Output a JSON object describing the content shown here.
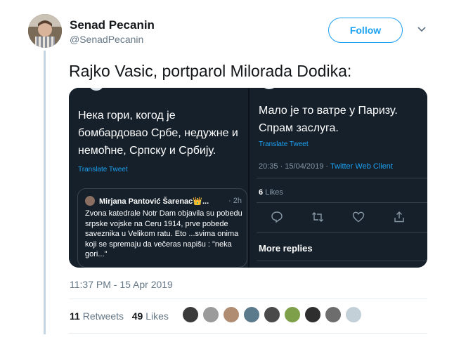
{
  "tweet": {
    "author": {
      "display_name": "Senad Pecanin",
      "handle": "@SenadPecanin"
    },
    "follow_label": "Follow",
    "text": "Rajko Vasic, portparol Milorada Dodika:",
    "timestamp": "11:37 PM - 15 Apr 2019",
    "retweets_count": "11",
    "retweets_label": "Retweets",
    "likes_count": "49",
    "likes_label": "Likes"
  },
  "screenshot_left": {
    "line1": "Нека гори, когод је",
    "line2": "бомбардовао Србе, недужне и",
    "line3": "немоћне, Српску и Србију.",
    "translate": "Translate Tweet",
    "quote": {
      "name": "Mirjana Pantović Šarenac👑...",
      "time": "· 2h",
      "body": "Zvona katedrale Notr Dam objavila su pobedu srpske vojske na Ceru 1914, prve pobede saveznika u Velikom ratu. Eto ...svima onima koji se spremaju da večeras napišu : \"neka gori...\""
    }
  },
  "screenshot_right": {
    "line1": "Мало је то ватре у Паризу.",
    "line2": "Спрам заслуга.",
    "translate": "Translate Tweet",
    "meta_time": "20:35 · 15/04/2019 · ",
    "meta_client": "Twitter Web Client",
    "likes_count": "6",
    "likes_label": "Likes",
    "more_replies": "More replies"
  },
  "colors": {
    "accent": "#1da1f2",
    "dark_bg": "#15202b",
    "muted": "#657786"
  },
  "likers": [
    {
      "name": "liker-avatar",
      "color": "#3a3a3a"
    },
    {
      "name": "liker-avatar",
      "color": "#9b9b9b"
    },
    {
      "name": "liker-avatar",
      "color": "#b08d72"
    },
    {
      "name": "liker-avatar",
      "color": "#5b7a8c"
    },
    {
      "name": "liker-avatar",
      "color": "#4a4a4a"
    },
    {
      "name": "liker-avatar",
      "color": "#7fa04a"
    },
    {
      "name": "liker-avatar",
      "color": "#2e2e2e"
    },
    {
      "name": "liker-avatar",
      "color": "#6d6d6d"
    },
    {
      "name": "liker-avatar",
      "color": "#c4d0d8"
    }
  ]
}
